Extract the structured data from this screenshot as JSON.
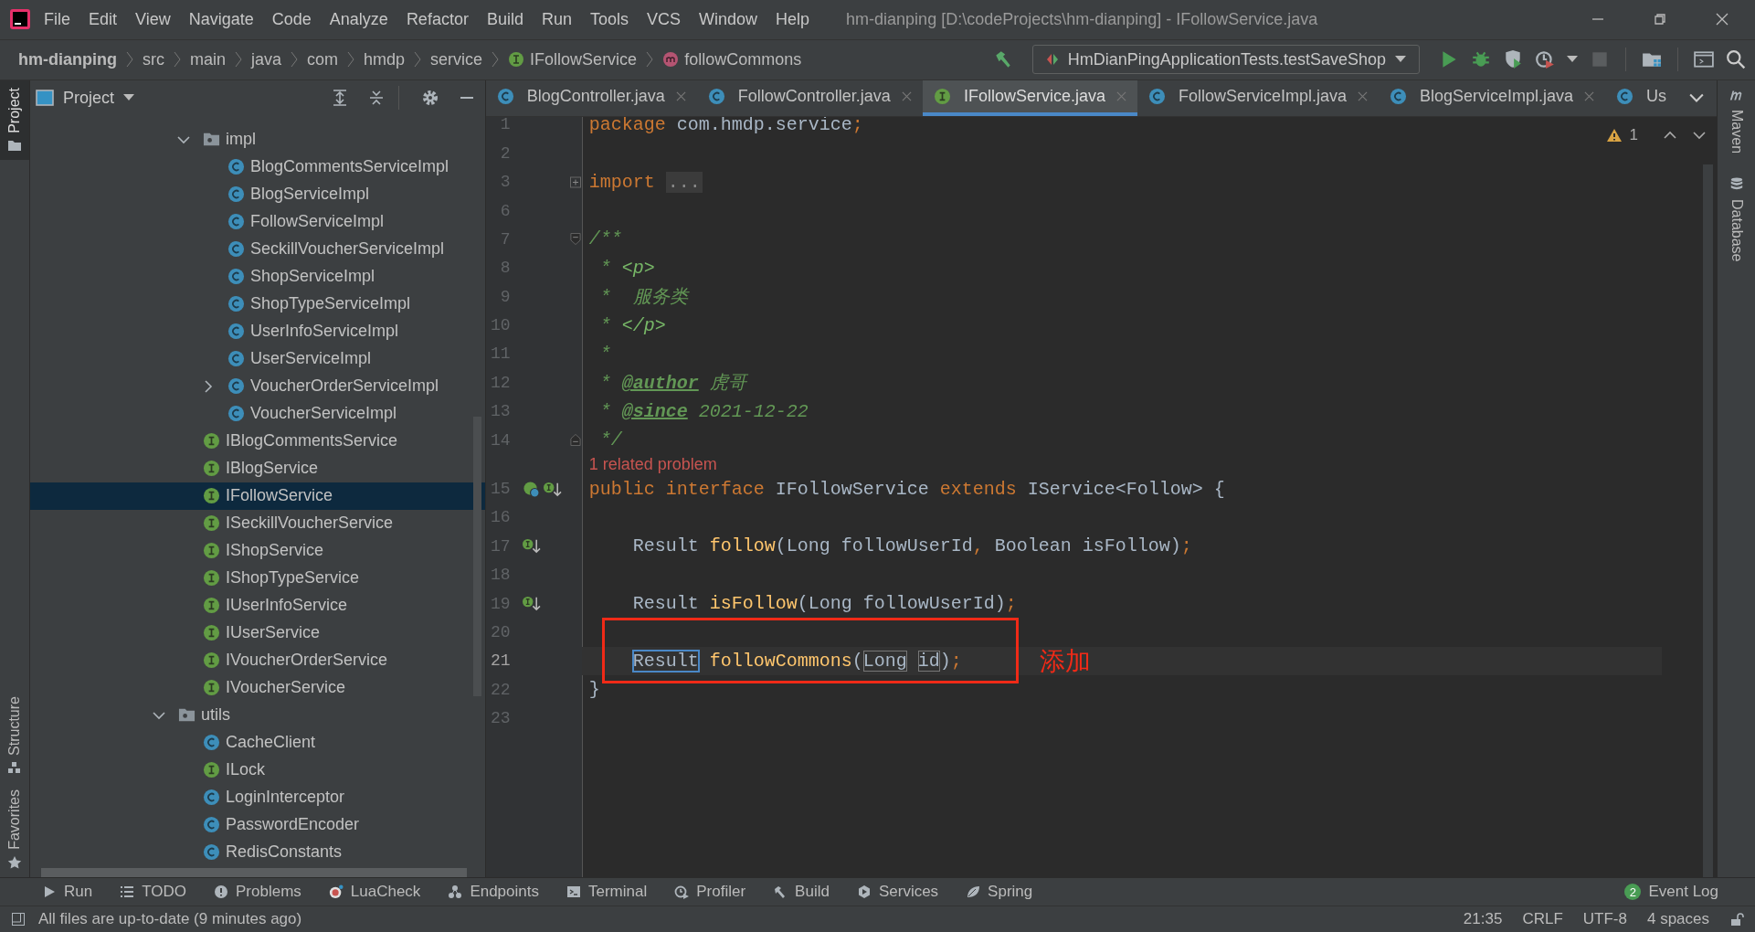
{
  "window": {
    "title": "hm-dianping [D:\\codeProjects\\hm-dianping] - IFollowService.java"
  },
  "menu": [
    "File",
    "Edit",
    "View",
    "Navigate",
    "Code",
    "Analyze",
    "Refactor",
    "Build",
    "Run",
    "Tools",
    "VCS",
    "Window",
    "Help"
  ],
  "breadcrumbs": [
    {
      "label": "hm-dianping",
      "kind": "project"
    },
    {
      "label": "src",
      "kind": "folder"
    },
    {
      "label": "main",
      "kind": "folder"
    },
    {
      "label": "java",
      "kind": "folder"
    },
    {
      "label": "com",
      "kind": "folder"
    },
    {
      "label": "hmdp",
      "kind": "folder"
    },
    {
      "label": "service",
      "kind": "folder"
    },
    {
      "label": "IFollowService",
      "kind": "interface"
    },
    {
      "label": "followCommons",
      "kind": "method"
    }
  ],
  "run_config": {
    "label": "HmDianPingApplicationTests.testSaveShop"
  },
  "left_stripe": [
    {
      "label": "Project",
      "kind": "project",
      "selected": true
    },
    {
      "label": "Structure",
      "kind": "structure",
      "selected": false
    },
    {
      "label": "Favorites",
      "kind": "favorites",
      "selected": false
    }
  ],
  "project_panel": {
    "title": "Project",
    "tree": [
      {
        "children": [
          {
            "label": "impl",
            "kind": "folder",
            "expanded": true,
            "selected": false,
            "children": [
              {
                "label": "BlogCommentsServiceImpl",
                "kind": "class",
                "selected": false
              },
              {
                "label": "BlogServiceImpl",
                "kind": "class",
                "selected": false
              },
              {
                "label": "FollowServiceImpl",
                "kind": "class",
                "selected": false
              },
              {
                "label": "SeckillVoucherServiceImpl",
                "kind": "class",
                "selected": false
              },
              {
                "label": "ShopServiceImpl",
                "kind": "class",
                "selected": false
              },
              {
                "label": "ShopTypeServiceImpl",
                "kind": "class",
                "selected": false
              },
              {
                "label": "UserInfoServiceImpl",
                "kind": "class",
                "selected": false
              },
              {
                "label": "UserServiceImpl",
                "kind": "class",
                "selected": false
              },
              {
                "label": "VoucherOrderServiceImpl",
                "kind": "class",
                "expanded": false,
                "selected": false
              },
              {
                "label": "VoucherServiceImpl",
                "kind": "class",
                "selected": false
              }
            ]
          },
          {
            "label": "IBlogCommentsService",
            "kind": "interface",
            "selected": false
          },
          {
            "label": "IBlogService",
            "kind": "interface",
            "selected": false
          },
          {
            "label": "IFollowService",
            "kind": "interface",
            "selected": true
          },
          {
            "label": "ISeckillVoucherService",
            "kind": "interface",
            "selected": false
          },
          {
            "label": "IShopService",
            "kind": "interface",
            "selected": false
          },
          {
            "label": "IShopTypeService",
            "kind": "interface",
            "selected": false
          },
          {
            "label": "IUserInfoService",
            "kind": "interface",
            "selected": false
          },
          {
            "label": "IUserService",
            "kind": "interface",
            "selected": false
          },
          {
            "label": "IVoucherOrderService",
            "kind": "interface",
            "selected": false
          },
          {
            "label": "IVoucherService",
            "kind": "interface",
            "selected": false
          }
        ]
      },
      {
        "label": "utils",
        "kind": "folder",
        "expanded": true,
        "selected": false,
        "children": [
          {
            "label": "CacheClient",
            "kind": "class",
            "selected": false
          },
          {
            "label": "ILock",
            "kind": "interface",
            "selected": false
          },
          {
            "label": "LoginInterceptor",
            "kind": "class",
            "selected": false
          },
          {
            "label": "PasswordEncoder",
            "kind": "class",
            "selected": false
          },
          {
            "label": "RedisConstants",
            "kind": "class",
            "selected": false
          }
        ]
      }
    ]
  },
  "tabs": [
    {
      "label": "BlogController.java",
      "kind": "class",
      "selected": false,
      "closable": true
    },
    {
      "label": "FollowController.java",
      "kind": "class",
      "selected": false,
      "closable": true
    },
    {
      "label": "IFollowService.java",
      "kind": "interface",
      "selected": true,
      "closable": true
    },
    {
      "label": "FollowServiceImpl.java",
      "kind": "class",
      "selected": false,
      "closable": true
    },
    {
      "label": "BlogServiceImpl.java",
      "kind": "class",
      "selected": false,
      "closable": true
    },
    {
      "label": "Us",
      "kind": "class",
      "selected": false,
      "closable": false
    }
  ],
  "editor": {
    "warnings": "1",
    "lines": [
      {
        "number": "1",
        "tokens": [
          {
            "text": "package",
            "kind": "keyword"
          },
          {
            "text": " com.hmdp.service",
            "kind": "plain"
          },
          {
            "text": ";",
            "kind": "punct"
          }
        ]
      },
      {
        "number": "2"
      },
      {
        "number": "3",
        "fold": {
          "kind": "expand"
        },
        "tokens": [
          {
            "text": "import",
            "kind": "keyword"
          },
          {
            "text": "...",
            "kind": "folded"
          }
        ]
      },
      {
        "number": "6"
      },
      {
        "number": "7",
        "fold": {
          "kind": "open"
        },
        "tokens": [
          {
            "text": "/**",
            "kind": "doc"
          }
        ]
      },
      {
        "number": "8",
        "tokens": [
          {
            "text": " * ",
            "kind": "doc"
          },
          {
            "text": "<p>",
            "kind": "docmarkup"
          }
        ]
      },
      {
        "number": "9",
        "tokens": [
          {
            "text": " *  ",
            "kind": "doc"
          },
          {
            "text": "服务类",
            "kind": "doc"
          }
        ]
      },
      {
        "number": "10",
        "tokens": [
          {
            "text": " * ",
            "kind": "doc"
          },
          {
            "text": "</p>",
            "kind": "docmarkup"
          }
        ]
      },
      {
        "number": "11",
        "tokens": [
          {
            "text": " *",
            "kind": "doc"
          }
        ]
      },
      {
        "number": "12",
        "tokens": [
          {
            "text": " * ",
            "kind": "doc"
          },
          {
            "text": "@author",
            "kind": "doctag"
          },
          {
            "text": " 虎哥",
            "kind": "doc"
          }
        ]
      },
      {
        "number": "13",
        "tokens": [
          {
            "text": " * ",
            "kind": "doc"
          },
          {
            "text": "@since",
            "kind": "doctag"
          },
          {
            "text": " 2021-12-22",
            "kind": "doc"
          }
        ]
      },
      {
        "number": "14",
        "fold": {
          "kind": "close"
        },
        "tokens": [
          {
            "text": " */",
            "kind": "doc"
          }
        ]
      },
      {
        "kind": "hint",
        "text": "1 related problem"
      },
      {
        "number": "15",
        "gutter": [
          {
            "kind": "implemented"
          },
          {
            "kind": "implementations"
          }
        ],
        "tokens": [
          {
            "text": "public",
            "kind": "keyword"
          },
          {
            "text": " interface",
            "kind": "keyword"
          },
          {
            "text": " IFollowService ",
            "kind": "plain"
          },
          {
            "text": "extends",
            "kind": "keyword"
          },
          {
            "text": " IService<Follow> {",
            "kind": "plain"
          }
        ]
      },
      {
        "number": "16"
      },
      {
        "number": "17",
        "indented": true,
        "gutter": [
          {
            "kind": "implementations"
          }
        ],
        "tokens": [
          {
            "text": "Result ",
            "kind": "plain"
          },
          {
            "text": "follow",
            "kind": "method"
          },
          {
            "text": "(Long followUserId",
            "kind": "plain"
          },
          {
            "text": ",",
            "kind": "punct"
          },
          {
            "text": " Boolean isFollow)",
            "kind": "plain"
          },
          {
            "text": ";",
            "kind": "punct"
          }
        ]
      },
      {
        "number": "18"
      },
      {
        "number": "19",
        "indented": true,
        "gutter": [
          {
            "kind": "implementations"
          }
        ],
        "tokens": [
          {
            "text": "Result ",
            "kind": "plain"
          },
          {
            "text": "isFollow",
            "kind": "method"
          },
          {
            "text": "(Long followUserId)",
            "kind": "plain"
          },
          {
            "text": ";",
            "kind": "punct"
          }
        ]
      },
      {
        "number": "20"
      },
      {
        "number": "21",
        "current": true,
        "indented": true,
        "tokens": [
          {
            "text": "Result",
            "kind": "plain",
            "selected": true
          },
          {
            "text": " followCommons",
            "kind": "method"
          },
          {
            "text": "(",
            "kind": "plain"
          },
          {
            "text": "Long",
            "kind": "plain",
            "matched": true
          },
          {
            "text": "id",
            "kind": "plain",
            "matched": true
          },
          {
            "text": ")",
            "kind": "plain"
          },
          {
            "text": ";",
            "kind": "punct"
          }
        ]
      },
      {
        "number": "22",
        "tokens": [
          {
            "text": "}",
            "kind": "plain"
          }
        ]
      },
      {
        "number": "23"
      }
    ],
    "annotation": {
      "text": "添加"
    }
  },
  "right_stripe": [
    {
      "label": "Maven",
      "kind": "maven"
    },
    {
      "label": "Database",
      "kind": "database"
    }
  ],
  "tool_strip": [
    {
      "label": "Run",
      "kind": "run"
    },
    {
      "label": "TODO",
      "kind": "todo"
    },
    {
      "label": "Problems",
      "kind": "problems"
    },
    {
      "label": "LuaCheck",
      "kind": "luacheck"
    },
    {
      "label": "Endpoints",
      "kind": "endpoints"
    },
    {
      "label": "Terminal",
      "kind": "terminal"
    },
    {
      "label": "Profiler",
      "kind": "profiler"
    },
    {
      "label": "Build",
      "kind": "build"
    },
    {
      "label": "Services",
      "kind": "services"
    },
    {
      "label": "Spring",
      "kind": "spring"
    }
  ],
  "event_log": {
    "count": "2",
    "label": "Event Log"
  },
  "status_bar": {
    "message": "All files are up-to-date (9 minutes ago)",
    "items": [
      "21:35",
      "CRLF",
      "UTF-8",
      "4 spaces"
    ]
  }
}
